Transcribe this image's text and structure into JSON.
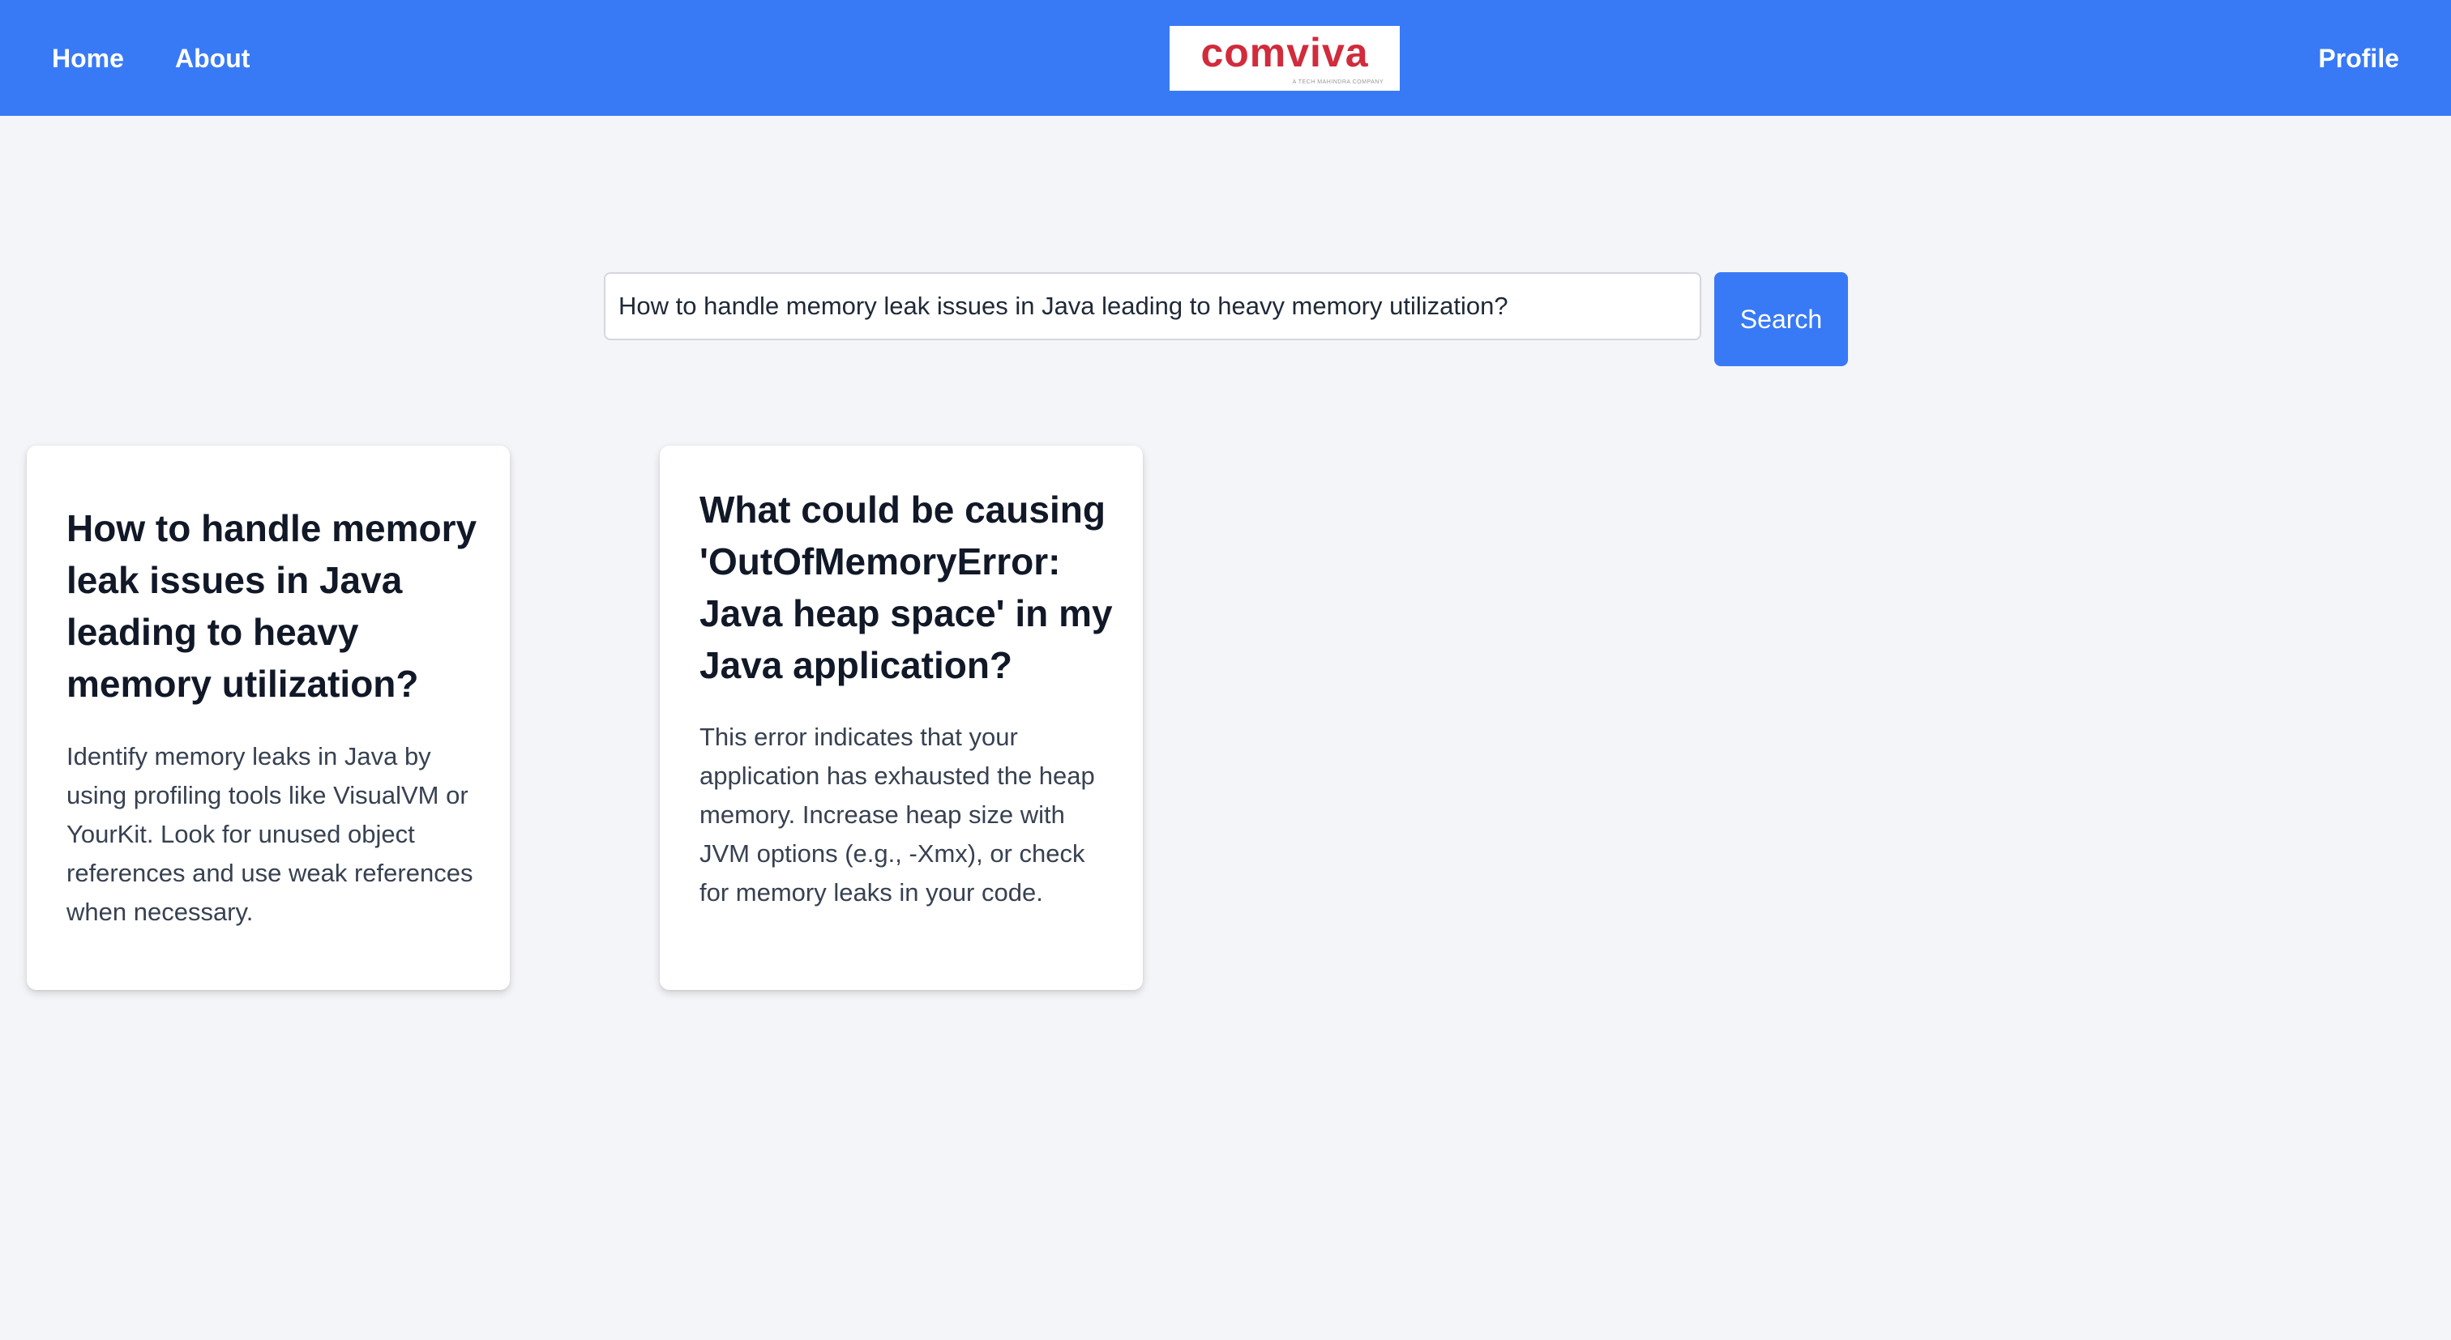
{
  "nav": {
    "home_label": "Home",
    "about_label": "About",
    "profile_label": "Profile",
    "accent_color": "#387af6"
  },
  "logo": {
    "wordmark": "comviva",
    "tagline": "A TECH MAHINDRA COMPANY"
  },
  "search": {
    "value": "How to handle memory leak issues in Java leading to heavy memory utilization?",
    "button_label": "Search"
  },
  "results": [
    {
      "title": "How to handle memory leak issues in Java leading to heavy memory utilization?",
      "body": "Identify memory leaks in Java by using profiling tools like VisualVM or YourKit. Look for unused object references and use weak references when necessary."
    },
    {
      "title": "What could be causing 'OutOfMemoryError: Java heap space' in my Java application?",
      "body": "This error indicates that your application has exhausted the heap memory. Increase heap size with JVM options (e.g., -Xmx), or check for memory leaks in your code."
    }
  ]
}
